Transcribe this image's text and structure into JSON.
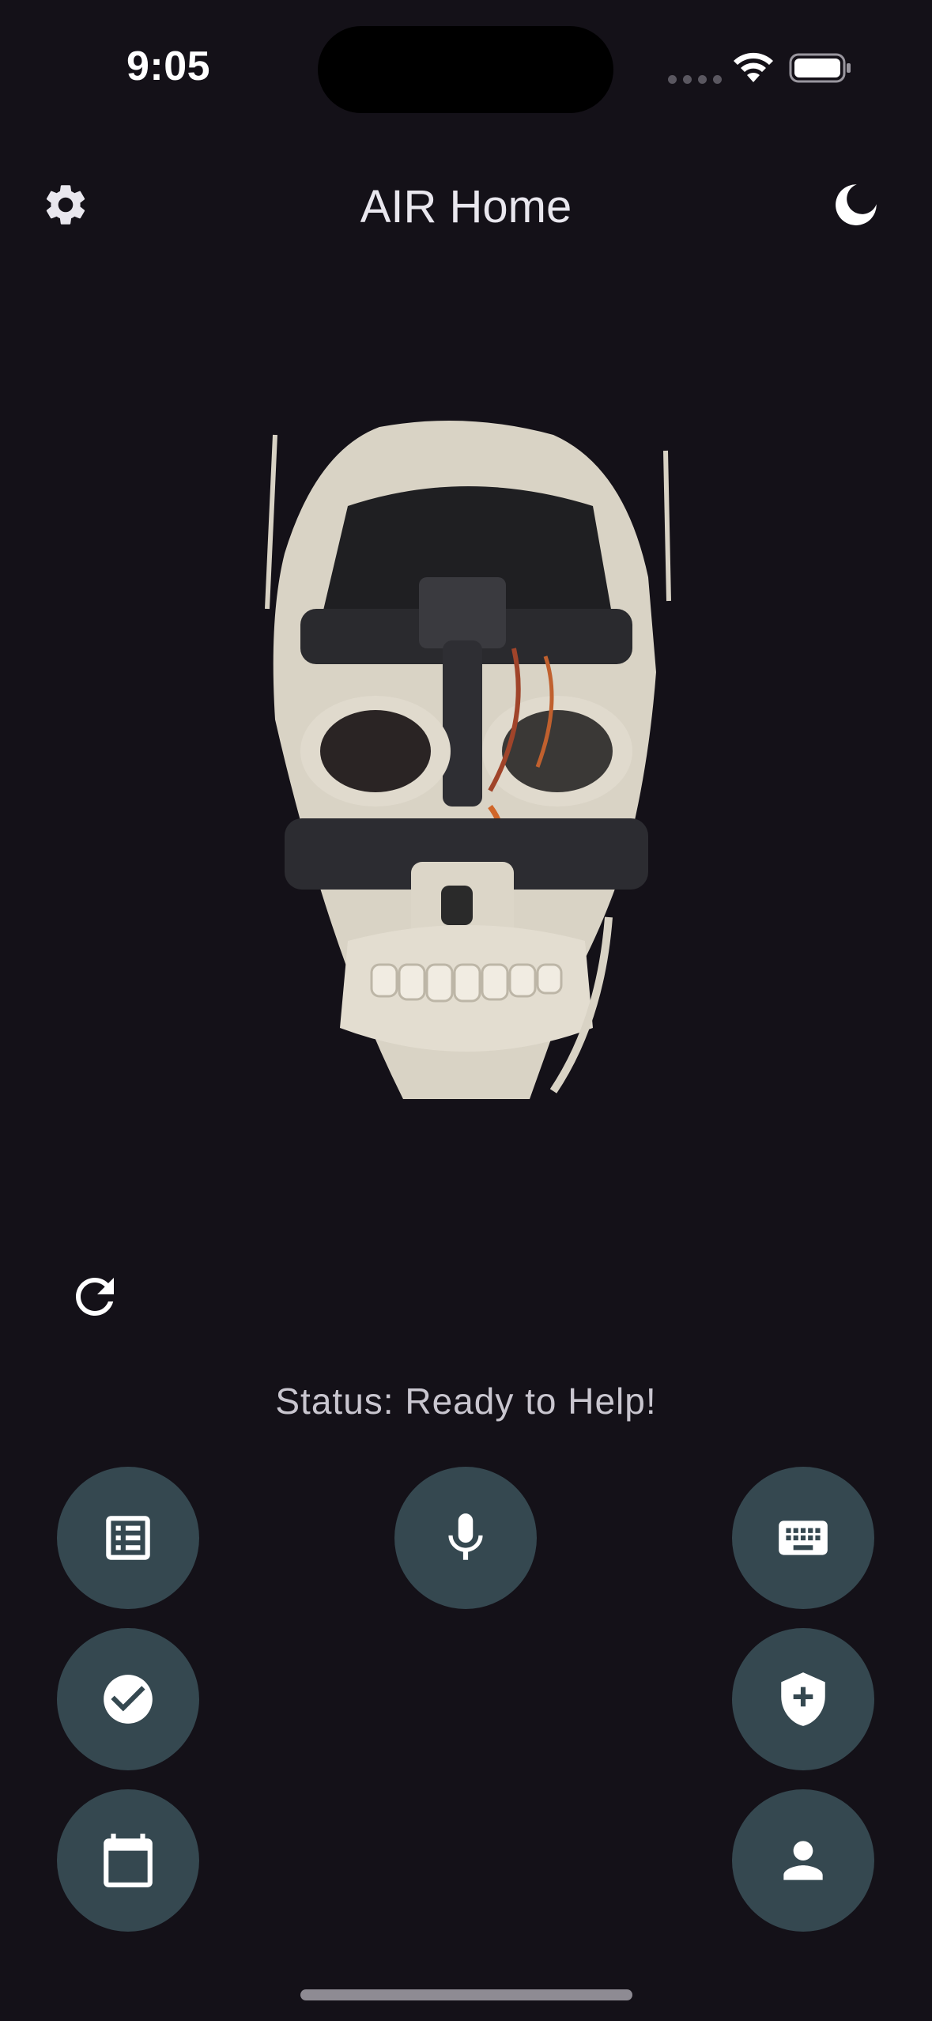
{
  "status_bar": {
    "time": "9:05"
  },
  "header": {
    "title": "AIR Home"
  },
  "main": {
    "status_text": "Status: Ready to Help!",
    "robot_image_alt": "robot-head"
  },
  "actions": [
    {
      "name": "list-icon"
    },
    {
      "name": "microphone-icon"
    },
    {
      "name": "keyboard-icon"
    },
    {
      "name": "check-circle-icon"
    },
    {
      "name": "shield-plus-icon"
    },
    {
      "name": "calendar-icon"
    },
    {
      "name": "person-icon"
    }
  ],
  "colors": {
    "background": "#141118",
    "fab": "#354850",
    "text": "#e9e7ee",
    "status": "#c9c6cf"
  }
}
